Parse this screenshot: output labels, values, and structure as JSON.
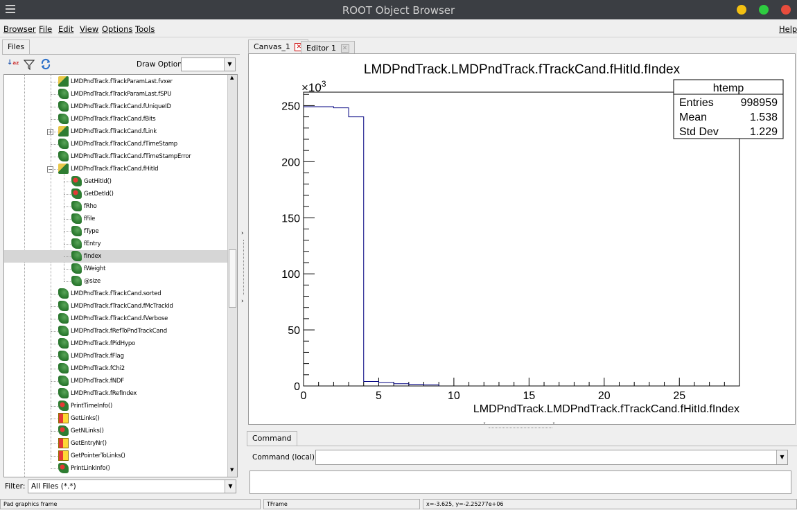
{
  "window": {
    "title": "ROOT Object Browser",
    "buttons": {
      "minimize": "#f3c012",
      "maximize": "#2ecc40",
      "close": "#e74c3c"
    }
  },
  "menu": {
    "browser": "Browser",
    "file": "File",
    "edit": "Edit",
    "view": "View",
    "options": "Options",
    "tools": "Tools",
    "help": "Help"
  },
  "left": {
    "tab": "Files",
    "draw_option_label": "Draw Option:",
    "draw_option_value": "",
    "filter_label": "Filter:",
    "filter_value": "All Files (*.*)",
    "tree": [
      {
        "label": "LMDPndTrack.fTrackParamLast.fvxer",
        "icon": "folder-leaf",
        "depth": 0
      },
      {
        "label": "LMDPndTrack.fTrackParamLast.fSPU",
        "icon": "leaf",
        "depth": 0
      },
      {
        "label": "LMDPndTrack.fTrackCand.fUniqueID",
        "icon": "leaf",
        "depth": 0
      },
      {
        "label": "LMDPndTrack.fTrackCand.fBits",
        "icon": "leaf",
        "depth": 0
      },
      {
        "label": "LMDPndTrack.fTrackCand.fLink",
        "icon": "folder-leaf",
        "depth": 0,
        "expander": "+"
      },
      {
        "label": "LMDPndTrack.fTrackCand.fTimeStamp",
        "icon": "leaf",
        "depth": 0
      },
      {
        "label": "LMDPndTrack.fTrackCand.fTimeStampError",
        "icon": "leaf",
        "depth": 0
      },
      {
        "label": "LMDPndTrack.fTrackCand.fHitId",
        "icon": "folder-leaf",
        "depth": 0,
        "expander": "−"
      },
      {
        "label": "GetHitId()",
        "icon": "func-leaf",
        "depth": 1
      },
      {
        "label": "GetDetId()",
        "icon": "func-leaf",
        "depth": 1
      },
      {
        "label": "fRho",
        "icon": "leaf",
        "depth": 1
      },
      {
        "label": "fFile",
        "icon": "leaf",
        "depth": 1
      },
      {
        "label": "fType",
        "icon": "leaf",
        "depth": 1
      },
      {
        "label": "fEntry",
        "icon": "leaf",
        "depth": 1
      },
      {
        "label": "fIndex",
        "icon": "leaf",
        "depth": 1,
        "selected": true
      },
      {
        "label": "fWeight",
        "icon": "leaf",
        "depth": 1
      },
      {
        "label": "@size",
        "icon": "leaf",
        "depth": 1
      },
      {
        "label": "LMDPndTrack.fTrackCand.sorted",
        "icon": "leaf",
        "depth": 0
      },
      {
        "label": "LMDPndTrack.fTrackCand.fMcTrackId",
        "icon": "leaf",
        "depth": 0
      },
      {
        "label": "LMDPndTrack.fTrackCand.fVerbose",
        "icon": "leaf",
        "depth": 0
      },
      {
        "label": "LMDPndTrack.fRefToPndTrackCand",
        "icon": "leaf",
        "depth": 0
      },
      {
        "label": "LMDPndTrack.fPidHypo",
        "icon": "leaf",
        "depth": 0
      },
      {
        "label": "LMDPndTrack.fFlag",
        "icon": "leaf",
        "depth": 0
      },
      {
        "label": "LMDPndTrack.fChi2",
        "icon": "leaf",
        "depth": 0
      },
      {
        "label": "LMDPndTrack.fNDF",
        "icon": "leaf",
        "depth": 0
      },
      {
        "label": "LMDPndTrack.fRefIndex",
        "icon": "leaf",
        "depth": 0
      },
      {
        "label": "PrintTimeInfo()",
        "icon": "func-leaf",
        "depth": 0
      },
      {
        "label": "GetLinks()",
        "icon": "function",
        "depth": 0
      },
      {
        "label": "GetNLinks()",
        "icon": "func-leaf",
        "depth": 0
      },
      {
        "label": "GetEntryNr()",
        "icon": "function",
        "depth": 0
      },
      {
        "label": "GetPointerToLinks()",
        "icon": "function",
        "depth": 0
      },
      {
        "label": "PrintLinkInfo()",
        "icon": "func-leaf",
        "depth": 0
      }
    ]
  },
  "tabs": [
    {
      "label": "Canvas_1",
      "close": "red"
    },
    {
      "label": "Editor 1",
      "close": "gray"
    }
  ],
  "stats": {
    "title": "htemp",
    "rows": [
      {
        "k": "Entries",
        "v": "998959"
      },
      {
        "k": "Mean",
        "v": "1.538"
      },
      {
        "k": "Std Dev",
        "v": "1.229"
      }
    ]
  },
  "chart_data": {
    "type": "histogram",
    "title": "LMDPndTrack.LMDPndTrack.fTrackCand.fHitId.fIndex",
    "xlabel": "LMDPndTrack.LMDPndTrack.fTrackCand.fHitId.fIndex",
    "ylabel": "",
    "y_multiplier": "×10",
    "y_multiplier_exp": "3",
    "xlim": [
      0,
      29
    ],
    "ylim": [
      0,
      262
    ],
    "xticks": [
      "0",
      "5",
      "10",
      "15",
      "20",
      "25"
    ],
    "yticks": [
      "0",
      "50",
      "100",
      "150",
      "200",
      "250"
    ],
    "bins": [
      {
        "x0": 0,
        "x1": 1,
        "y": 249
      },
      {
        "x0": 1,
        "x1": 2,
        "y": 249
      },
      {
        "x0": 2,
        "x1": 3,
        "y": 248
      },
      {
        "x0": 3,
        "x1": 4,
        "y": 240
      },
      {
        "x0": 4,
        "x1": 5,
        "y": 4
      },
      {
        "x0": 5,
        "x1": 6,
        "y": 3
      },
      {
        "x0": 6,
        "x1": 7,
        "y": 2
      },
      {
        "x0": 7,
        "x1": 8,
        "y": 1.5
      },
      {
        "x0": 8,
        "x1": 9,
        "y": 1
      }
    ],
    "line_color": "#000080"
  },
  "command": {
    "tab": "Command",
    "label": "Command (local):",
    "value": ""
  },
  "status": {
    "pad": "Pad graphics frame",
    "object": "TFrame",
    "coords": "x=-3.625, y=-2.25277e+06"
  }
}
